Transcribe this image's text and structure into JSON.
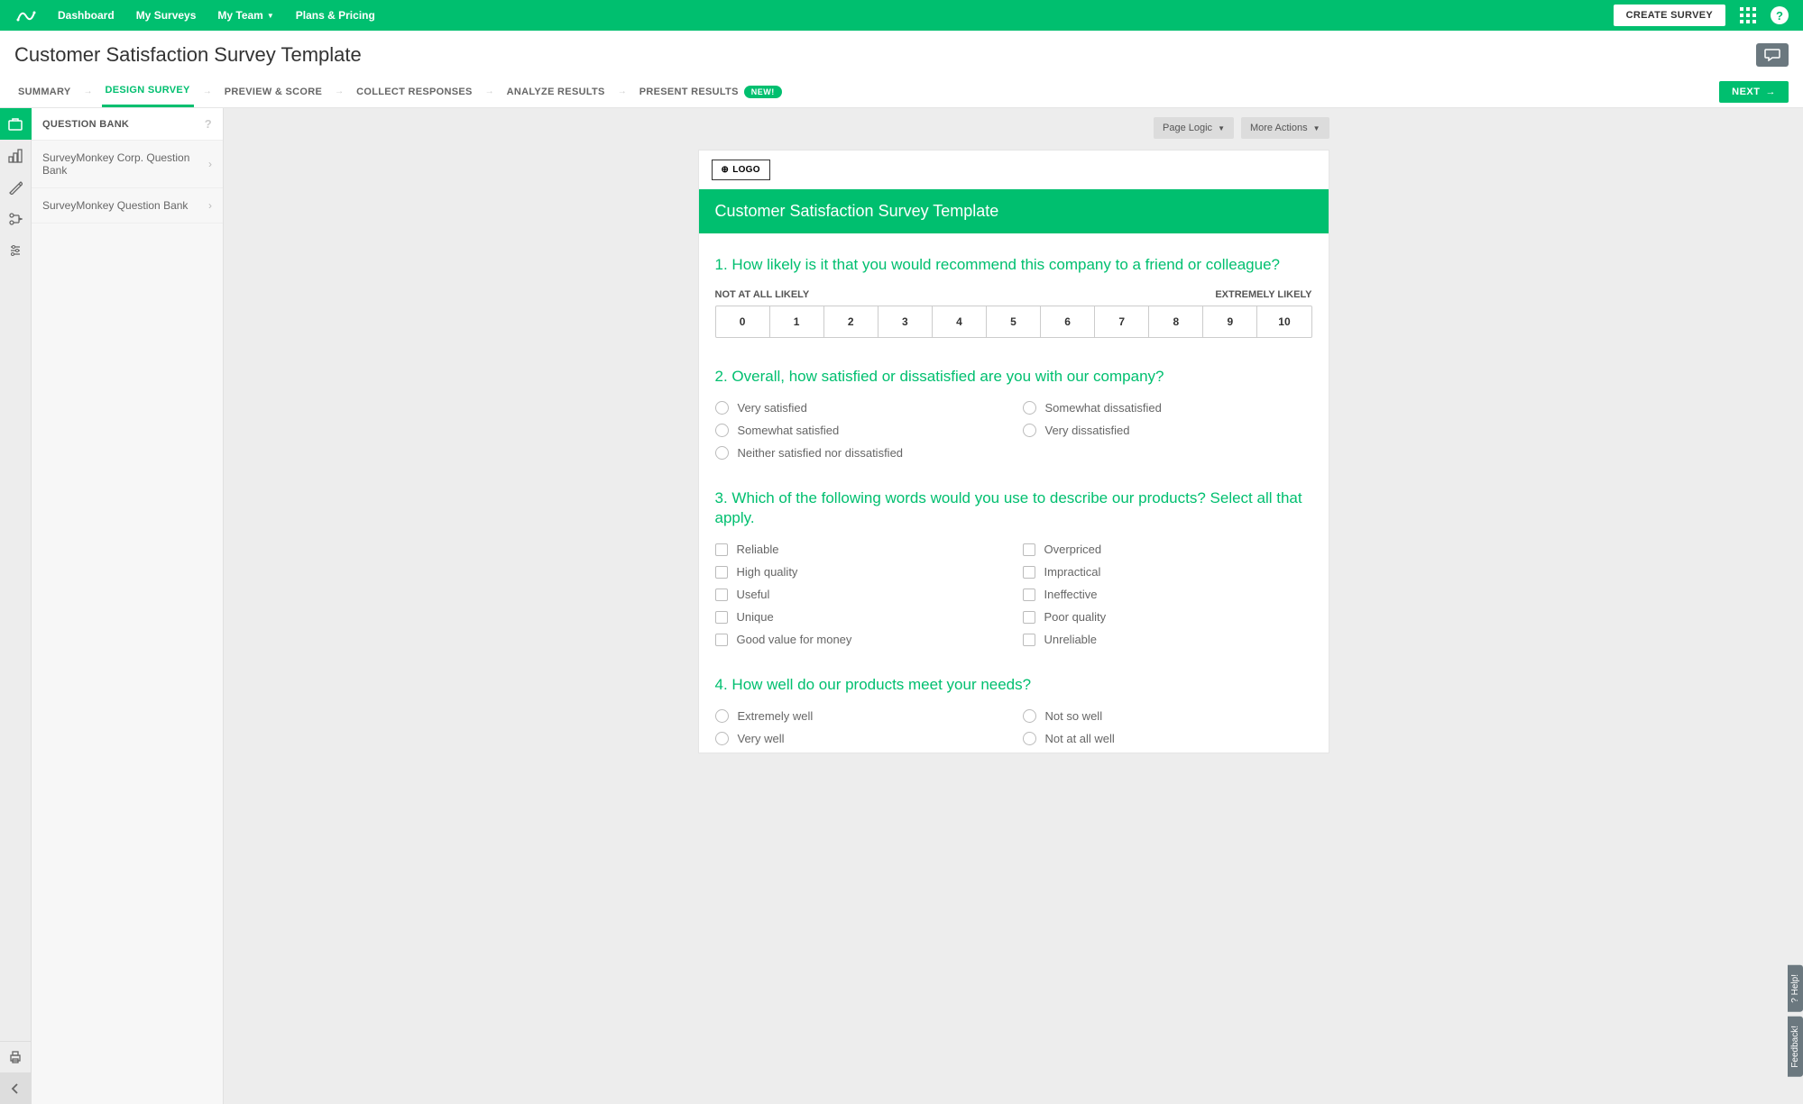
{
  "topnav": {
    "links": [
      "Dashboard",
      "My Surveys",
      "My Team",
      "Plans & Pricing"
    ],
    "create": "CREATE SURVEY"
  },
  "title": "Customer Satisfaction Survey Template",
  "steps": {
    "items": [
      "SUMMARY",
      "DESIGN SURVEY",
      "PREVIEW & SCORE",
      "COLLECT RESPONSES",
      "ANALYZE RESULTS",
      "PRESENT RESULTS"
    ],
    "activeIndex": 1,
    "badge": "NEW!",
    "next": "NEXT"
  },
  "sidepanel": {
    "header": "QUESTION BANK",
    "rows": [
      "SurveyMonkey Corp. Question Bank",
      "SurveyMonkey Question Bank"
    ]
  },
  "toolbar": {
    "pageLogic": "Page Logic",
    "moreActions": "More Actions"
  },
  "logoBtn": "LOGO",
  "surveyTitle": "Customer Satisfaction Survey Template",
  "q1": {
    "num": "1.",
    "text": "How likely is it that you would recommend this company to a friend or colleague?",
    "leftLabel": "NOT AT ALL LIKELY",
    "rightLabel": "EXTREMELY LIKELY",
    "scale": [
      "0",
      "1",
      "2",
      "3",
      "4",
      "5",
      "6",
      "7",
      "8",
      "9",
      "10"
    ]
  },
  "q2": {
    "num": "2.",
    "text": "Overall, how satisfied or dissatisfied are you with our company?",
    "options": [
      "Very satisfied",
      "Somewhat satisfied",
      "Neither satisfied nor dissatisfied",
      "Somewhat dissatisfied",
      "Very dissatisfied"
    ]
  },
  "q3": {
    "num": "3.",
    "text": "Which of the following words would you use to describe our products? Select all that apply.",
    "options": [
      "Reliable",
      "High quality",
      "Useful",
      "Unique",
      "Good value for money",
      "Overpriced",
      "Impractical",
      "Ineffective",
      "Poor quality",
      "Unreliable"
    ]
  },
  "q4": {
    "num": "4.",
    "text": "How well do our products meet your needs?",
    "options": [
      "Extremely well",
      "Very well",
      "Not so well",
      "Not at all well"
    ]
  },
  "sideTabs": {
    "help": "? Help!",
    "feedback": "Feedback!"
  }
}
